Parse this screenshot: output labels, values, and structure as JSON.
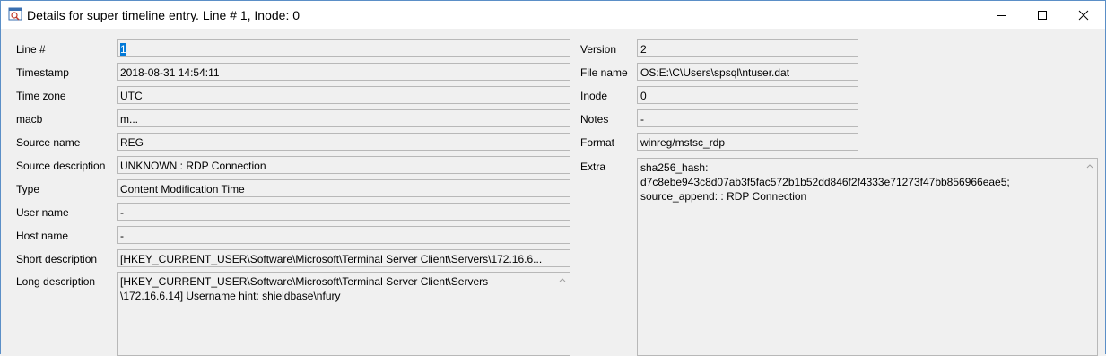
{
  "window": {
    "title": "Details for super timeline entry. Line # 1, Inode: 0"
  },
  "left": {
    "fields": [
      {
        "label": "Line #",
        "value": "1"
      },
      {
        "label": "Timestamp",
        "value": "2018-08-31 14:54:11"
      },
      {
        "label": "Time zone",
        "value": "UTC"
      },
      {
        "label": "macb",
        "value": "m..."
      },
      {
        "label": "Source name",
        "value": "REG"
      },
      {
        "label": "Source description",
        "value": "UNKNOWN : RDP Connection"
      },
      {
        "label": "Type",
        "value": "Content Modification Time"
      },
      {
        "label": "User name",
        "value": "-"
      },
      {
        "label": "Host name",
        "value": "-"
      },
      {
        "label": "Short description",
        "value": "[HKEY_CURRENT_USER\\Software\\Microsoft\\Terminal Server Client\\Servers\\172.16.6..."
      }
    ],
    "long_description": {
      "label": "Long description",
      "lines": [
        "[HKEY_CURRENT_USER\\Software\\Microsoft\\Terminal Server Client\\Servers",
        "\\172.16.6.14] Username hint: shieldbase\\nfury"
      ]
    }
  },
  "right": {
    "fields": [
      {
        "label": "Version",
        "value": "2"
      },
      {
        "label": "File name",
        "value": "OS:E:\\C\\Users\\spsql\\ntuser.dat"
      },
      {
        "label": "Inode",
        "value": "0"
      },
      {
        "label": "Notes",
        "value": "-"
      },
      {
        "label": "Format",
        "value": "winreg/mstsc_rdp"
      }
    ],
    "extra": {
      "label": "Extra",
      "lines": [
        "sha256_hash:",
        "d7c8ebe943c8d07ab3f5fac572b1b52dd846f2f4333e71273f47bb856966eae5;",
        "source_append: : RDP Connection"
      ]
    }
  }
}
